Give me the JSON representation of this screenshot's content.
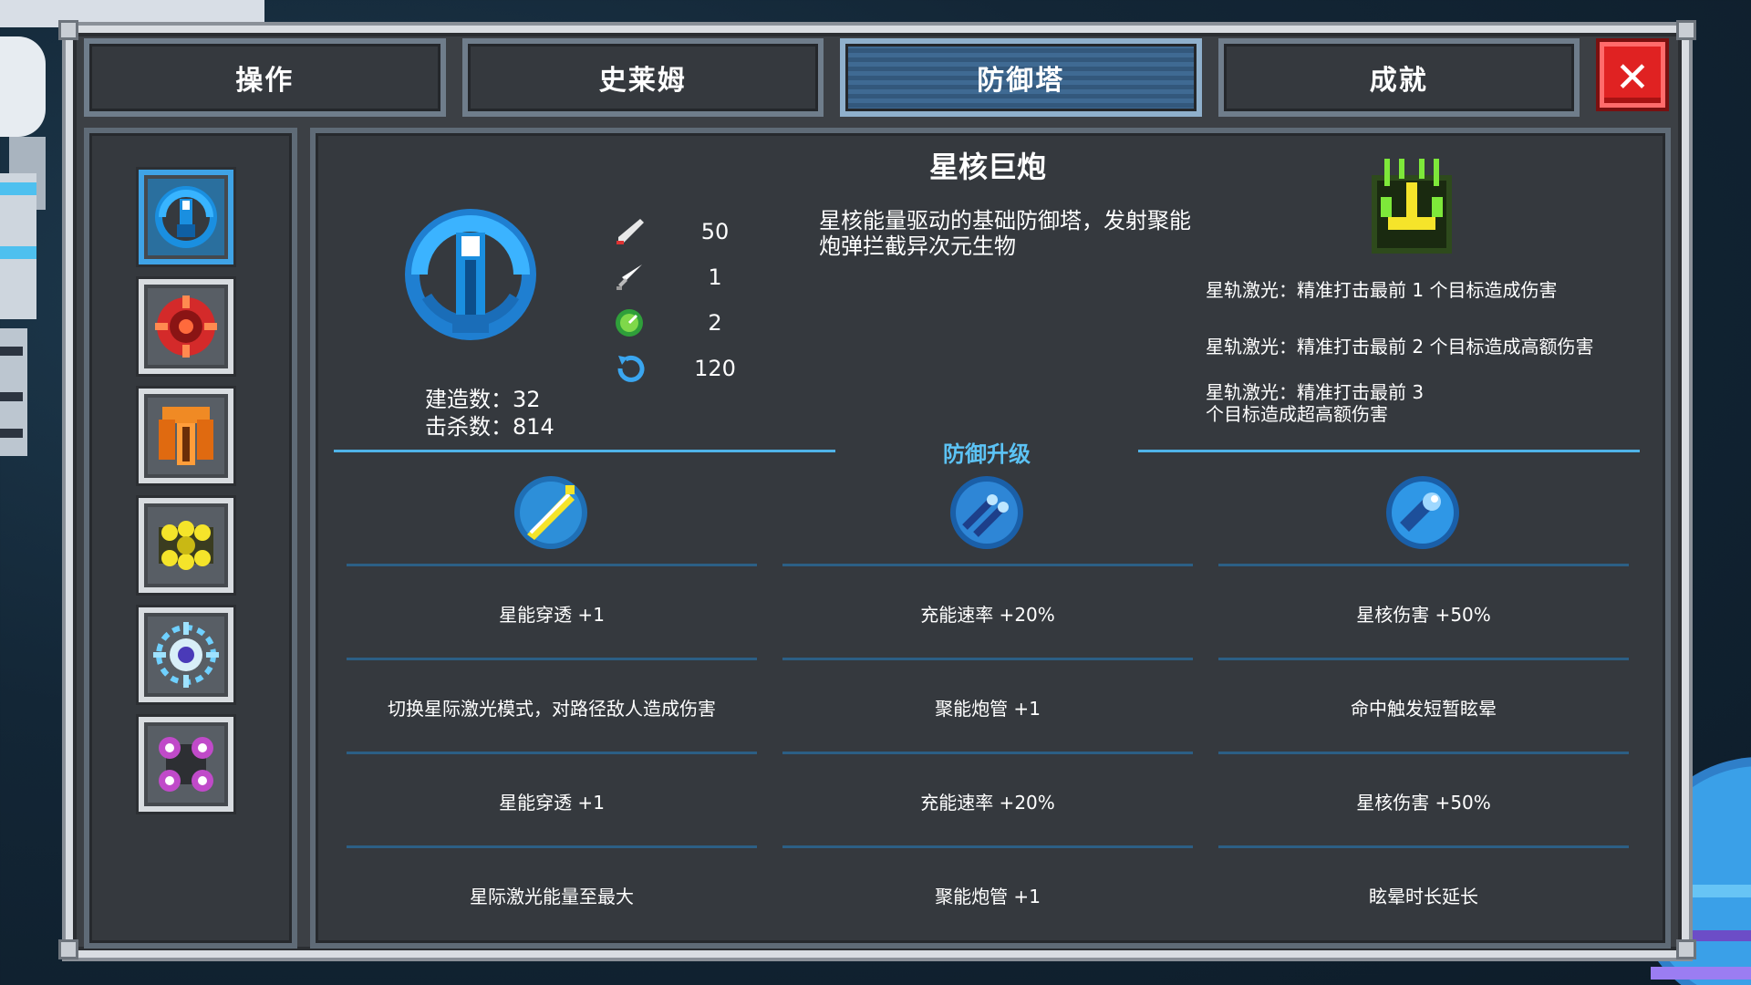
{
  "tabs": [
    "操作",
    "史莱姆",
    "防御塔",
    "成就"
  ],
  "active_tab": 2,
  "close_label": "✕",
  "sidebar": {
    "towers": [
      {
        "icon": "star-core-cannon-icon",
        "active": true
      },
      {
        "icon": "red-tower-icon",
        "active": false
      },
      {
        "icon": "orange-tower-icon",
        "active": false
      },
      {
        "icon": "yellow-tower-icon",
        "active": false
      },
      {
        "icon": "blue-snowflake-tower-icon",
        "active": false
      },
      {
        "icon": "purple-tower-icon",
        "active": false
      }
    ]
  },
  "tower": {
    "name": "星核巨炮",
    "build_count": "建造数：32",
    "kill_count": "击杀数：814",
    "stats": [
      {
        "icon": "damage-icon",
        "value": "50"
      },
      {
        "icon": "pierce-icon",
        "value": "1"
      },
      {
        "icon": "range-icon",
        "value": "2"
      },
      {
        "icon": "reload-icon",
        "value": "120"
      }
    ],
    "description": "星核能量驱动的基础防御塔，发射聚能炮弹拦截异次元生物",
    "skill": {
      "icon": "laser-skill-icon",
      "lines": [
        "星轨激光：精准打击最前 1 个目标造成伤害",
        "星轨激光：精准打击最前 2 个目标造成高额伤害",
        "星轨激光：精准打击最前 3\n个目标造成超高额伤害"
      ]
    }
  },
  "upgrades": {
    "title": "防御升级",
    "columns": [
      {
        "icon": "yellow-beam-icon",
        "items": [
          "星能穿透 +1",
          "切换星际激光模式，对路径敌人造成伤害",
          "星能穿透 +1",
          "星际激光能量至最大"
        ]
      },
      {
        "icon": "blue-barrage-icon",
        "items": [
          "充能速率 +20%",
          "聚能炮管 +1",
          "充能速率 +20%",
          "聚能炮管 +1"
        ]
      },
      {
        "icon": "blue-orb-icon",
        "items": [
          "星核伤害 +50%",
          "命中触发短暂眩晕",
          "星核伤害 +50%",
          "眩晕时长延长"
        ]
      }
    ]
  },
  "colors": {
    "accent": "#4fb3e8",
    "panel": "#35393e",
    "close": "#e02222"
  }
}
